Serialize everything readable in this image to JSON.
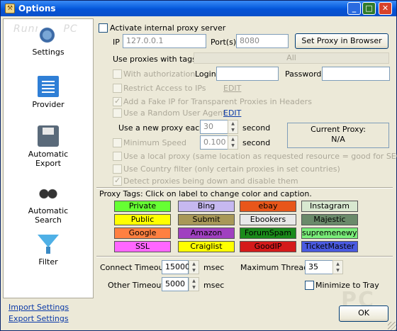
{
  "window": {
    "title": "Options",
    "watermark": "Running PC"
  },
  "sidebar": {
    "items": [
      {
        "label": "Settings",
        "icon": "gear-icon"
      },
      {
        "label": "Provider",
        "icon": "list-icon"
      },
      {
        "label": "Automatic Export",
        "icon": "floppy-icon"
      },
      {
        "label": "Automatic Search",
        "icon": "binoculars-icon"
      },
      {
        "label": "Filter",
        "icon": "funnel-icon"
      }
    ]
  },
  "links": {
    "import": "Import Settings",
    "export": "Export Settings"
  },
  "proxy": {
    "activate_label": "Activate internal proxy server",
    "ip_label": "IP",
    "ip_value": "127.0.0.1",
    "port_label": "Port(s)",
    "port_value": "8080",
    "set_button": "Set Proxy in Browser",
    "use_tags_label": "Use proxies with tags:",
    "tags_value": "All",
    "with_auth_label": "With authorization",
    "login_label": "Login",
    "password_label": "Password",
    "restrict_label": "Restrict Access to IPs",
    "edit1": "EDIT",
    "fake_ip_label": "Add a Fake IP for Transparent Proxies in Headers",
    "random_ua_label": "Use a Random User Agent",
    "edit2": "EDIT",
    "new_proxy_label": "Use a new proxy each",
    "new_proxy_value": "30",
    "second1": "second",
    "min_speed_label": "Minimum Speed",
    "min_speed_value": "0.100",
    "second2": "second",
    "current_proxy_label": "Current Proxy:",
    "current_proxy_value": "N/A",
    "local_proxy_label": "Use a local proxy (same location as requested resource = good for SEO)",
    "country_filter_label": "Use Country filter (only certain proxies in set countries)",
    "detect_down_label": "Detect proxies being down and disable them"
  },
  "tags": {
    "header": "Proxy Tags: Click on label to change color and caption.",
    "items": [
      {
        "label": "Private",
        "bg": "#66ff33",
        "fg": "#000000"
      },
      {
        "label": "Bing",
        "bg": "#c6b8f0",
        "fg": "#000000"
      },
      {
        "label": "ebay",
        "bg": "#e8561a",
        "fg": "#000000"
      },
      {
        "label": "Instagram",
        "bg": "#d8e8d0",
        "fg": "#000000"
      },
      {
        "label": "Public",
        "bg": "#ffff00",
        "fg": "#000000"
      },
      {
        "label": "Submit",
        "bg": "#a89858",
        "fg": "#000000"
      },
      {
        "label": "Ebookers",
        "bg": "#e8e8e8",
        "fg": "#000000"
      },
      {
        "label": "Majestic",
        "bg": "#6a8a6a",
        "fg": "#000000"
      },
      {
        "label": "Google",
        "bg": "#ff8040",
        "fg": "#000000"
      },
      {
        "label": "Amazon",
        "bg": "#a040c0",
        "fg": "#000000"
      },
      {
        "label": "ForumSpam",
        "bg": "#1a8a1a",
        "fg": "#000000"
      },
      {
        "label": "supremenewyork",
        "bg": "#7aee7a",
        "fg": "#000000"
      },
      {
        "label": "SSL",
        "bg": "#ff66ff",
        "fg": "#000000"
      },
      {
        "label": "Craiglist",
        "bg": "#ffff00",
        "fg": "#000000"
      },
      {
        "label": "GoodIP",
        "bg": "#d41a1a",
        "fg": "#000000"
      },
      {
        "label": "TicketMaster",
        "bg": "#4a5ae0",
        "fg": "#000000"
      }
    ]
  },
  "timeouts": {
    "connect_label": "Connect Timeout",
    "connect_value": "15000",
    "connect_unit": "msec",
    "other_label": "Other Timeout",
    "other_value": "5000",
    "other_unit": "msec",
    "threads_label": "Maximum Threads",
    "threads_value": "35",
    "minimize_label": "Minimize to Tray"
  },
  "ok_button": "OK",
  "corner_mark": "PC"
}
